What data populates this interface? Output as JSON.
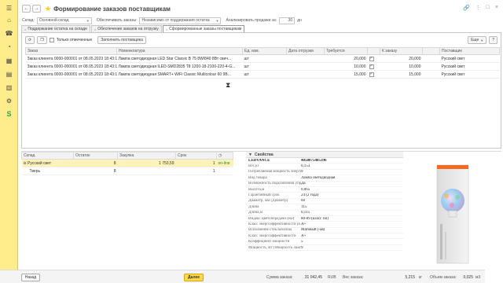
{
  "window": {
    "title": "Формирование заказов поставщикам",
    "back_icon": "←",
    "forward_icon": "→",
    "star_icon": "★",
    "link_icon": "🔗",
    "more_icon": "⋮",
    "maximize_icon": "□",
    "close_icon": "×"
  },
  "sidebar": {
    "icons": [
      "☰",
      "⌂",
      "☎",
      "◔",
      "▦",
      "▤",
      "▥",
      "⚙",
      "S"
    ]
  },
  "filters": {
    "warehouse_label": "Склад:",
    "warehouse_value": "Основной склад",
    "provide_label": "Обеспечивать заказы:",
    "provide_value": "Независимо от поддержания остатка",
    "analyze_label": "Анализировать продажи за:",
    "analyze_value": "30",
    "analyze_unit": "дн"
  },
  "tabs": [
    {
      "label": "Поддержание остатка на складе"
    },
    {
      "label": "Обеспечение заказов на отгрузку"
    },
    {
      "label": "Сформированные заказы поставщикам"
    }
  ],
  "toolbar": {
    "only_marked_label": "Только отмеченные",
    "fill_supplier_label": "Заполнить поставщика",
    "more_label": "Еще",
    "help_label": "?",
    "check_mark": "✓"
  },
  "orders": {
    "columns": [
      "Заказ",
      "Номенклатура",
      "Ед. изм.",
      "Дата отгрузки",
      "Требуется",
      "",
      "К заказу",
      "",
      "Поставщик"
    ],
    "rows": [
      {
        "order": "Заказ клиента 0000-000001 от 08.05.2023 18:43:19",
        "item": "Лампа светодиодная LED Star Classic B 75 8W/840 8Вт свеч...",
        "unit": "шт",
        "date": "",
        "required": "20,000",
        "to_order": "20,000",
        "supplier": "Русский свет"
      },
      {
        "order": "Заказ клиента 0000-000001 от 08.05.2023 18:43:19",
        "item": "Лампа светодиодная ILED-SMD2835 T8 1200-18-2100-220-4-G...",
        "unit": "шт",
        "date": "",
        "required": "10,000",
        "to_order": "10,000",
        "supplier": "Русский свет"
      },
      {
        "order": "Заказ клиента 0000-000001 от 08.05.2023 18:43:19",
        "item": "Лампа светодиодная SMART+ WiFi Classic Multicolour 60 9В...",
        "unit": "шт",
        "date": "",
        "required": "15,000",
        "to_order": "15,000",
        "supplier": "Русский свет"
      }
    ]
  },
  "stock": {
    "columns": [
      "Склад",
      "Остаток",
      "Закупка",
      "Срок",
      ""
    ],
    "rows": [
      {
        "prefix": "⊖",
        "name": "Русский свет",
        "rest": "8",
        "price": "1 753,59",
        "term": "1",
        "status": "on-line"
      },
      {
        "prefix": "",
        "name": "Тверь",
        "rest": "8",
        "price": "",
        "term": "1",
        "status": ""
      }
    ]
  },
  "properties": {
    "header": "Свойства",
    "rows": [
      {
        "label": "LEDVANCE",
        "value": "4058075485396"
      },
      {
        "label": "Вес,кг",
        "value": "0,153"
      },
      {
        "label": "Потребляемая мощность энергии за 1000 часов",
        "value": "9"
      },
      {
        "label": "Вид товара",
        "value": "Лампа светодиодная"
      },
      {
        "label": "Возможность подключения управления",
        "value": "Да"
      },
      {
        "label": "Высота,м",
        "value": "0,065"
      },
      {
        "label": "Гарантийный срок",
        "value": "24 (2 года)"
      },
      {
        "label": "Диаметр, мм (Диаметр)",
        "value": "60"
      },
      {
        "label": "Длина",
        "value": "115"
      },
      {
        "label": "Длина,м",
        "value": "0,115"
      },
      {
        "label": "Индекс цветопередачи (Ra)",
        "value": "80-89 (класс 1В)"
      },
      {
        "label": "Класс энергоэффективности (EEI)",
        "value": "A+"
      },
      {
        "label": "Исполнение стекла/колбы",
        "value": "Матовый (-ая)"
      },
      {
        "label": "Класс энергоэффективности",
        "value": "A+"
      },
      {
        "label": "Коэффициент мощности",
        "value": "5"
      },
      {
        "label": "Мощность, Вт (Мощность лампы)",
        "value": "9"
      }
    ]
  },
  "footer": {
    "back_label": "Назад",
    "next_label": "Далее",
    "sum_label": "Сумма заказа:",
    "sum_value": "31 042,45",
    "sum_currency": "RUB",
    "weight_label": "Вес заказа:",
    "weight_value": "5,215",
    "weight_unit": "кг",
    "volume_label": "Объем заказа:",
    "volume_value": "0,025",
    "volume_unit": "м3"
  },
  "colors": {
    "sidebar": "#ffec8a",
    "selected_row": "#fdf2b8",
    "primary_button": "#ffd94a",
    "online": "#2a8a2a"
  }
}
